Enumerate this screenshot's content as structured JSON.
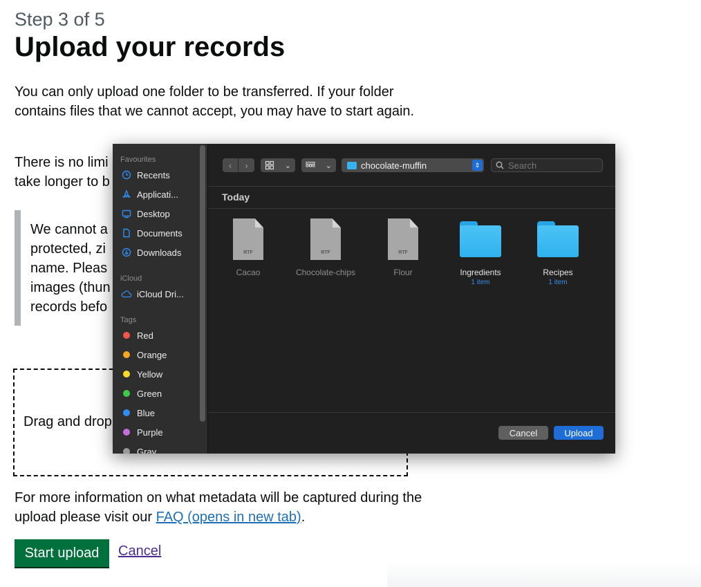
{
  "page": {
    "step": "Step 3 of 5",
    "title": "Upload your records",
    "intro": "You can only upload one folder to be transferred. If your folder contains files that we cannot accept, you may have to start again.",
    "limit_text_line1": "There is no limi",
    "limit_text_line2": "take longer to b",
    "inset_lines": [
      "We cannot a",
      "protected, zi",
      "name. Pleas",
      "images (thun",
      "records befo"
    ],
    "dropzone_text": "Drag and drop",
    "more_info_text": "For more information on what metadata will be captured during the upload please visit our ",
    "faq_link": "FAQ (opens in new tab)",
    "more_info_end": ".",
    "start_button": "Start upload",
    "cancel_link": "Cancel"
  },
  "dialog": {
    "sidebar": {
      "favourites_label": "Favourites",
      "favourites": [
        {
          "label": "Recents",
          "icon": "clock-icon"
        },
        {
          "label": "Applicati...",
          "icon": "applications-icon"
        },
        {
          "label": "Desktop",
          "icon": "desktop-icon"
        },
        {
          "label": "Documents",
          "icon": "document-icon"
        },
        {
          "label": "Downloads",
          "icon": "download-icon"
        }
      ],
      "icloud_label": "iCloud",
      "icloud_items": [
        {
          "label": "iCloud Dri...",
          "icon": "cloud-icon"
        }
      ],
      "tags_label": "Tags",
      "tags": [
        {
          "label": "Red",
          "color": "#f2554b"
        },
        {
          "label": "Orange",
          "color": "#f5a623"
        },
        {
          "label": "Yellow",
          "color": "#f7d82c"
        },
        {
          "label": "Green",
          "color": "#3fc94a"
        },
        {
          "label": "Blue",
          "color": "#2f8cf0"
        },
        {
          "label": "Purple",
          "color": "#c66de0"
        },
        {
          "label": "Gray",
          "color": "#9a9a9a"
        }
      ]
    },
    "toolbar": {
      "path_folder": "chocolate-muffin",
      "search_placeholder": "Search"
    },
    "section_header": "Today",
    "files": [
      {
        "name": "Cacao",
        "type": "rtf",
        "ext": "RTF"
      },
      {
        "name": "Chocolate-chips",
        "type": "rtf",
        "ext": "RTF"
      },
      {
        "name": "Flour",
        "type": "rtf",
        "ext": "RTF"
      },
      {
        "name": "Ingredients",
        "type": "folder",
        "count": "1 item"
      },
      {
        "name": "Recipes",
        "type": "folder",
        "count": "1 item"
      }
    ],
    "buttons": {
      "cancel": "Cancel",
      "upload": "Upload"
    }
  }
}
